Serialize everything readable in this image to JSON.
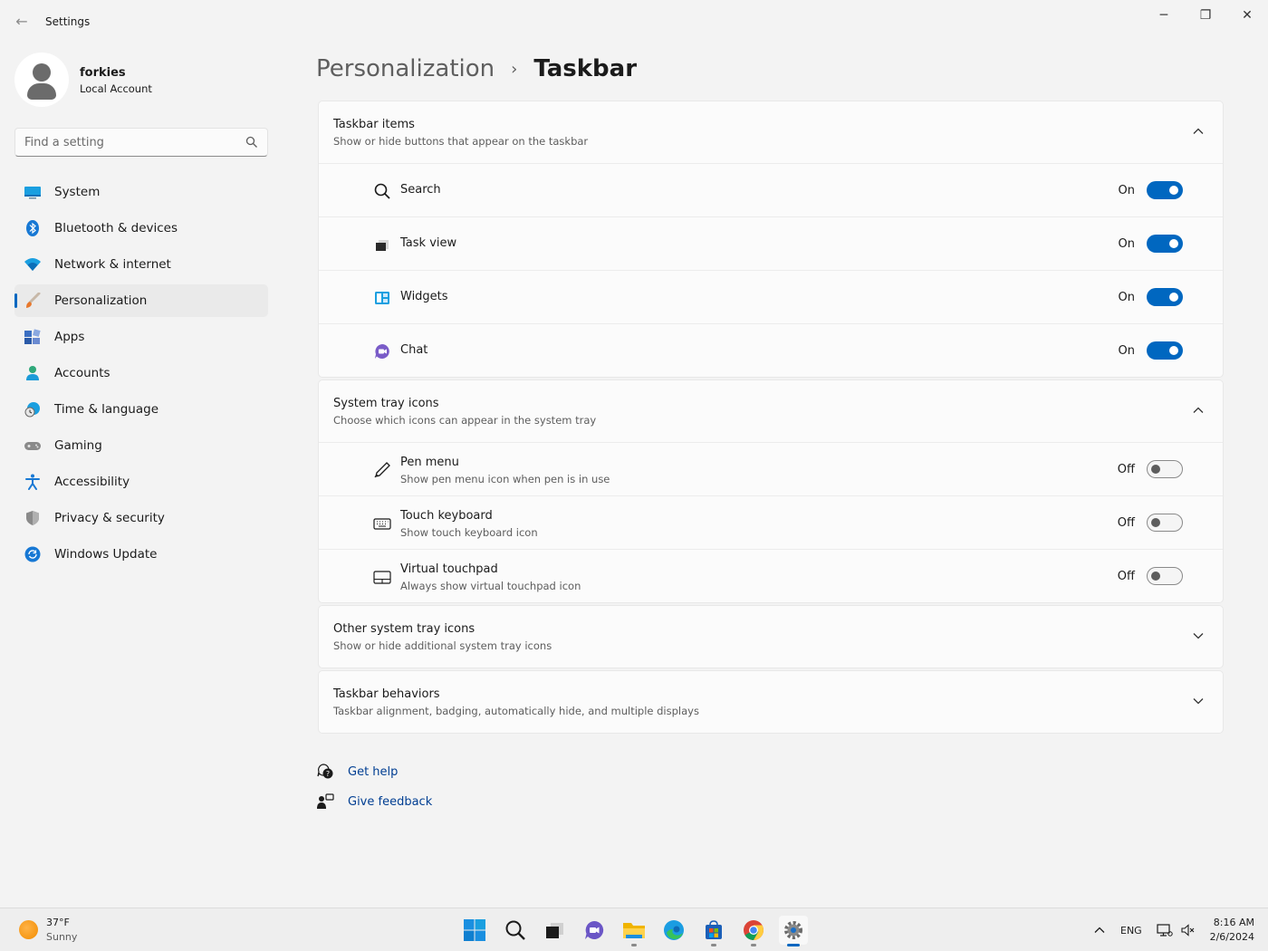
{
  "window": {
    "title": "Settings",
    "back": "←",
    "minimize": "─",
    "restore": "❐",
    "close": "✕"
  },
  "profile": {
    "name": "forkies",
    "account_type": "Local Account"
  },
  "search": {
    "placeholder": "Find a setting"
  },
  "nav": {
    "items": [
      {
        "label": "System",
        "icon": "monitor-icon"
      },
      {
        "label": "Bluetooth & devices",
        "icon": "bluetooth-icon"
      },
      {
        "label": "Network & internet",
        "icon": "wifi-icon"
      },
      {
        "label": "Personalization",
        "icon": "brush-icon",
        "active": true
      },
      {
        "label": "Apps",
        "icon": "apps-icon"
      },
      {
        "label": "Accounts",
        "icon": "person-icon"
      },
      {
        "label": "Time & language",
        "icon": "globe-clock-icon"
      },
      {
        "label": "Gaming",
        "icon": "gamepad-icon"
      },
      {
        "label": "Accessibility",
        "icon": "accessibility-icon"
      },
      {
        "label": "Privacy & security",
        "icon": "shield-icon"
      },
      {
        "label": "Windows Update",
        "icon": "refresh-icon"
      }
    ]
  },
  "breadcrumb": {
    "parent": "Personalization",
    "separator": "›",
    "current": "Taskbar"
  },
  "sections": {
    "taskbar_items": {
      "title": "Taskbar items",
      "subtitle": "Show or hide buttons that appear on the taskbar",
      "expanded": true,
      "rows": [
        {
          "label": "Search",
          "state": "On",
          "icon": "search-icon"
        },
        {
          "label": "Task view",
          "state": "On",
          "icon": "task-view-icon"
        },
        {
          "label": "Widgets",
          "state": "On",
          "icon": "widgets-icon"
        },
        {
          "label": "Chat",
          "state": "On",
          "icon": "chat-icon"
        }
      ]
    },
    "system_tray": {
      "title": "System tray icons",
      "subtitle": "Choose which icons can appear in the system tray",
      "expanded": true,
      "rows": [
        {
          "label": "Pen menu",
          "sub": "Show pen menu icon when pen is in use",
          "state": "Off",
          "icon": "pen-icon"
        },
        {
          "label": "Touch keyboard",
          "sub": "Show touch keyboard icon",
          "state": "Off",
          "icon": "keyboard-icon"
        },
        {
          "label": "Virtual touchpad",
          "sub": "Always show virtual touchpad icon",
          "state": "Off",
          "icon": "touchpad-icon"
        }
      ]
    },
    "other_tray": {
      "title": "Other system tray icons",
      "subtitle": "Show or hide additional system tray icons",
      "expanded": false
    },
    "behaviors": {
      "title": "Taskbar behaviors",
      "subtitle": "Taskbar alignment, badging, automatically hide, and multiple displays",
      "expanded": false
    }
  },
  "help": {
    "get_help": "Get help",
    "give_feedback": "Give feedback"
  },
  "taskbar": {
    "weather": {
      "temp": "37°F",
      "condition": "Sunny"
    },
    "apps": [
      "start-icon",
      "search-icon",
      "task-view-icon",
      "chat-icon",
      "file-explorer-icon",
      "edge-icon",
      "store-icon",
      "chrome-icon",
      "settings-icon"
    ],
    "tray": {
      "chevron": "^",
      "language": "ENG"
    },
    "clock": {
      "time": "8:16 AM",
      "date": "2/6/2024"
    }
  },
  "colors": {
    "accent": "#0067c0",
    "link": "#003e92",
    "background": "#f3f3f3",
    "card": "#fbfbfb"
  }
}
